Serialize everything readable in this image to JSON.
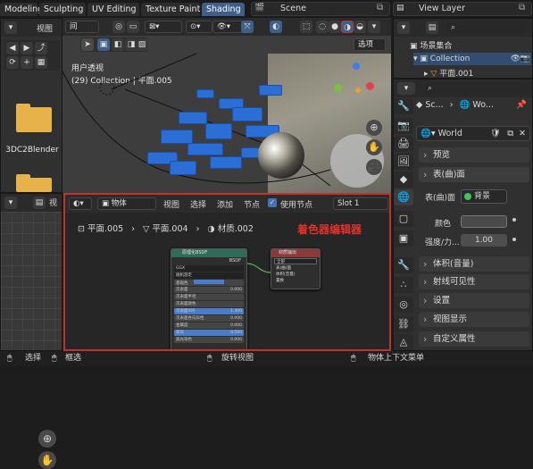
{
  "workspace_tabs": [
    {
      "label": "Modeling"
    },
    {
      "label": "Sculpting"
    },
    {
      "label": "UV Editing"
    },
    {
      "label": "Texture Paint"
    },
    {
      "label": "Shading",
      "active": true
    }
  ],
  "scene": {
    "label": "Scene"
  },
  "view_layer": {
    "label": "View Layer"
  },
  "file_browser": {
    "view_menu": "视图",
    "folder_label": "3DC2Blender"
  },
  "viewport": {
    "perspective_label": "用户透视",
    "collection_label": "(29) Collection | 平面.005",
    "options_label": "选项"
  },
  "outliner": {
    "items": [
      {
        "label": "场景集合"
      },
      {
        "label": "Collection"
      },
      {
        "label": "平面.001"
      }
    ]
  },
  "properties": {
    "breadcrumb_scene": "Sc...",
    "breadcrumb_world": "Wo...",
    "world_name": "World",
    "sections": {
      "preview": "预览",
      "surface": "表(曲)面",
      "volume": "体积(音量)",
      "ray_visibility": "射线可见性",
      "settings": "设置",
      "viewport_display": "视图显示",
      "custom_props": "自定义属性"
    },
    "surface_label": "表(曲)面",
    "surface_value": "背景",
    "color_label": "颜色",
    "color_swatch": "#4a4a4a",
    "strength_label": "强度/力...",
    "strength_value": "1.00"
  },
  "shader_editor": {
    "object_label": "物体",
    "menu": {
      "view": "视图",
      "select": "选择",
      "add": "添加",
      "node": "节点"
    },
    "use_nodes_label": "使用节点",
    "slot_label": "Slot 1",
    "path": {
      "plane5": "平面.005",
      "plane4": "平面.004",
      "material": "材质.002"
    },
    "annotation": "着色器编辑器",
    "bsdf_node": {
      "title": "原理化BSDF",
      "output_label": "BSDF",
      "rows": [
        "GGX",
        "随机游走",
        "基础色",
        "次表面",
        "次表面半径",
        "次表面颜色",
        "次表面IOR",
        "次表面各向异性",
        "金属度",
        "高光",
        "高光染色"
      ],
      "values": [
        "",
        "",
        "",
        "0.000",
        "",
        "",
        "1.400",
        "0.000",
        "0.000",
        "0.500",
        "0.000"
      ]
    },
    "output_node": {
      "title": "材质输出",
      "rows": [
        "全部",
        "表(曲)面",
        "体积(音量)",
        "置换"
      ]
    }
  },
  "status_bar": {
    "select": "选择",
    "box_select": "框选",
    "rotate_view": "旋转视图",
    "context_menu": "物体上下文菜单"
  },
  "colors": {
    "accent": "#3f5f8a",
    "annotation_red": "#c0322c",
    "lego_blue": "#2b6fd6",
    "folder": "#e8b24a",
    "surface_dot": "#3ec45a"
  }
}
